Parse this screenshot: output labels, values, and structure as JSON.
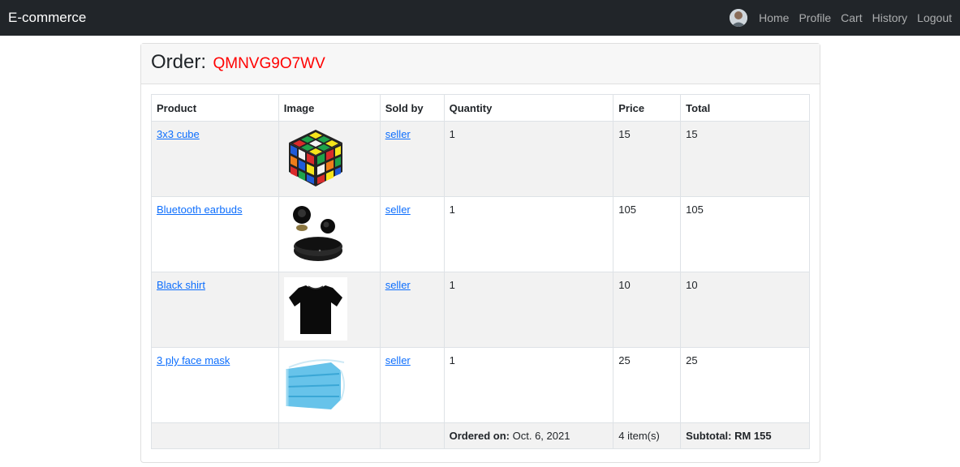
{
  "nav": {
    "brand": "E-commerce",
    "links": [
      "Home",
      "Profile",
      "Cart",
      "History",
      "Logout"
    ]
  },
  "order": {
    "label": "Order:",
    "code": "QMNVG9O7WV"
  },
  "table": {
    "headers": [
      "Product",
      "Image",
      "Sold by",
      "Quantity",
      "Price",
      "Total"
    ],
    "rows": [
      {
        "product": "3x3 cube",
        "image": "rubiks-cube-icon",
        "seller": "seller",
        "quantity": "1",
        "price": "15",
        "total": "15"
      },
      {
        "product": "Bluetooth earbuds",
        "image": "earbuds-icon",
        "seller": "seller",
        "quantity": "1",
        "price": "105",
        "total": "105"
      },
      {
        "product": "Black shirt",
        "image": "black-shirt-icon",
        "seller": "seller",
        "quantity": "1",
        "price": "10",
        "total": "10"
      },
      {
        "product": "3 ply face mask",
        "image": "face-mask-icon",
        "seller": "seller",
        "quantity": "1",
        "price": "25",
        "total": "25"
      }
    ],
    "footer": {
      "ordered_on_label": "Ordered on:",
      "ordered_on_value": "Oct. 6, 2021",
      "item_count": "4 item(s)",
      "subtotal": "Subtotal: RM 155"
    }
  },
  "colors": {
    "navbar": "#212529",
    "order_code": "#ff0000",
    "link": "#0d6efd",
    "stripe": "#f2f2f2"
  }
}
